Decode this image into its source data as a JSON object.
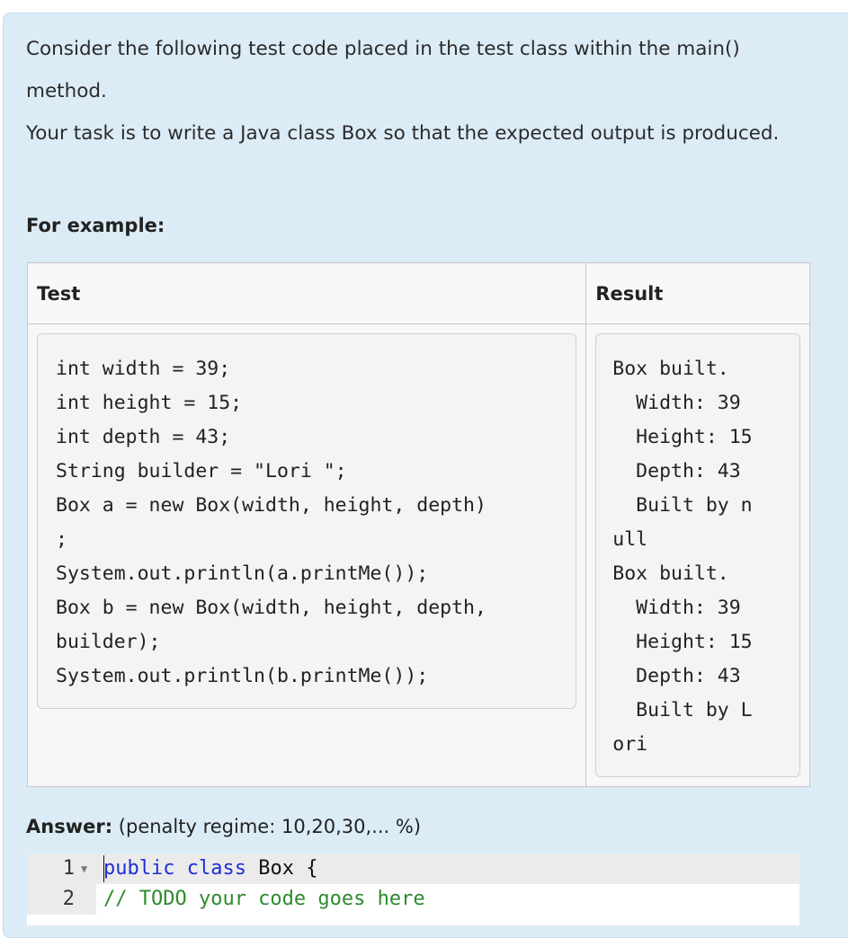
{
  "question": {
    "paragraph1": "Consider the following test code placed in the test class within the main() method.",
    "paragraph2": "Your task is to write a Java class Box so that the expected output is produced.",
    "example_label": "For example:"
  },
  "examples_table": {
    "headers": {
      "test": "Test",
      "result": "Result"
    },
    "test_code": "int width = 39;\nint height = 15;\nint depth = 43;\nString builder = \"Lori \";\nBox a = new Box(width, height, depth)\n;\nSystem.out.println(a.printMe());\nBox b = new Box(width, height, depth,\nbuilder);\nSystem.out.println(b.printMe());",
    "result_output": "Box built.\n  Width: 39\n  Height: 15\n  Depth: 43\n  Built by n\null\nBox built.\n  Width: 39\n  Height: 15\n  Depth: 43\n  Built by L\nori"
  },
  "answer": {
    "label": "Answer:",
    "penalty": "(penalty regime: 10,20,30,... %)"
  },
  "editor": {
    "lines": [
      {
        "number": "1",
        "keyword1": "public",
        "keyword2": "class",
        "rest": "Box {"
      },
      {
        "number": "2",
        "comment": "// TODO your code goes here"
      }
    ],
    "fold_icon": "fold-arrow-icon"
  }
}
